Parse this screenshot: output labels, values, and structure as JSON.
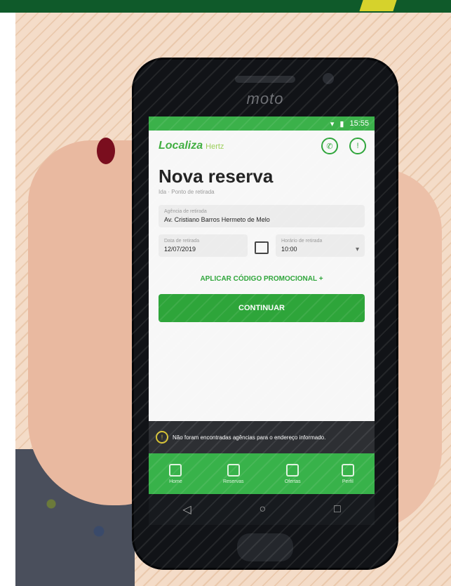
{
  "phone_brand": "moto",
  "status_bar": {
    "time": "15:55"
  },
  "app": {
    "brand": "Localiza",
    "brand_sub": "Hertz",
    "title": "Nova reserva",
    "subtitle": "Ida · Ponto de retirada",
    "pickup_label": "Agência de retirada",
    "pickup_value": "Av. Cristiano Barros Hermeto de Melo",
    "date_label": "Data de retirada",
    "date_value": "12/07/2019",
    "time_label": "Horário de retirada",
    "time_value": "10:00",
    "promo": "APLICAR CÓDIGO PROMOCIONAL +",
    "continue": "CONTINUAR"
  },
  "warning": {
    "text": "Não foram encontradas agências para o endereço informado."
  },
  "nav": [
    {
      "label": "Home"
    },
    {
      "label": "Reservas"
    },
    {
      "label": "Ofertas"
    },
    {
      "label": "Perfil"
    }
  ],
  "sys_nav": {
    "back": "◁",
    "home": "○",
    "recent": "□"
  },
  "colors": {
    "brand_green": "#2ea53a",
    "dark_band": "#0f5a2a",
    "accent_yellow": "#d6d22c"
  }
}
